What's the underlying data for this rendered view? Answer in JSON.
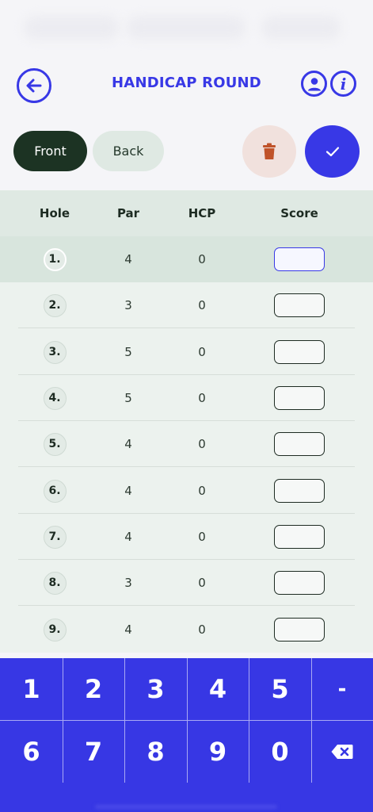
{
  "header": {
    "title": "HANDICAP ROUND",
    "back_icon": "arrow-left-icon",
    "profile_icon": "user-icon",
    "info_icon": "info-icon",
    "info_glyph": "i"
  },
  "tabs": [
    {
      "label": "Front",
      "selected": true
    },
    {
      "label": "Back",
      "selected": false
    }
  ],
  "actions": {
    "delete_icon": "trash-icon",
    "confirm_icon": "check-icon"
  },
  "table": {
    "columns": [
      "Hole",
      "Par",
      "HCP",
      "Score"
    ],
    "rows": [
      {
        "hole": "1.",
        "par": "4",
        "hcp": "0",
        "score": ""
      },
      {
        "hole": "2.",
        "par": "3",
        "hcp": "0",
        "score": ""
      },
      {
        "hole": "3.",
        "par": "5",
        "hcp": "0",
        "score": ""
      },
      {
        "hole": "4.",
        "par": "5",
        "hcp": "0",
        "score": ""
      },
      {
        "hole": "5.",
        "par": "4",
        "hcp": "0",
        "score": ""
      },
      {
        "hole": "6.",
        "par": "4",
        "hcp": "0",
        "score": ""
      },
      {
        "hole": "7.",
        "par": "4",
        "hcp": "0",
        "score": ""
      },
      {
        "hole": "8.",
        "par": "3",
        "hcp": "0",
        "score": ""
      },
      {
        "hole": "9.",
        "par": "4",
        "hcp": "0",
        "score": ""
      }
    ]
  },
  "keypad": {
    "row1": [
      "1",
      "2",
      "3",
      "4",
      "5",
      "-"
    ],
    "row2": [
      "6",
      "7",
      "8",
      "9",
      "0"
    ],
    "backspace_icon": "backspace-icon"
  },
  "colors": {
    "accent": "#3838e6",
    "selected_tab": "#1c3323",
    "delete_bg": "#f1e1dd",
    "delete_icon": "#c0532a"
  }
}
